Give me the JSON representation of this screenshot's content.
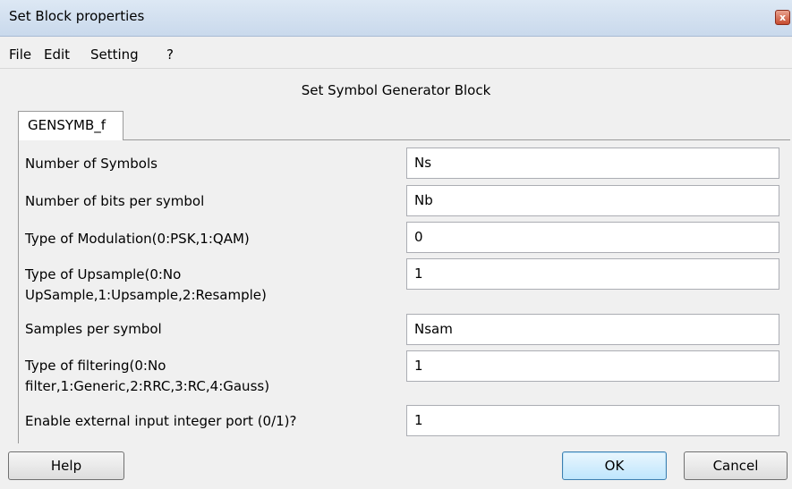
{
  "window": {
    "title": "Set Block properties",
    "close_glyph": "x"
  },
  "menu": {
    "items": [
      "File",
      "Edit",
      "Setting",
      "?"
    ]
  },
  "header": {
    "title": "Set Symbol Generator Block"
  },
  "tabs": [
    {
      "label": "GENSYMB_f",
      "selected": true
    }
  ],
  "fields": [
    {
      "label": "Number of Symbols",
      "value": "Ns"
    },
    {
      "label": "Number of bits per symbol",
      "value": "Nb"
    },
    {
      "label": "Type of Modulation(0:PSK,1:QAM)",
      "value": "0"
    },
    {
      "label": "Type of Upsample(0:No\nUpSample,1:Upsample,2:Resample)",
      "label_line1": "Type of Upsample(0:No",
      "label_line2": "UpSample,1:Upsample,2:Resample)",
      "value": "1"
    },
    {
      "label": "Samples per symbol",
      "value": "Nsam"
    },
    {
      "label": "Type of filtering(0:No\nfilter,1:Generic,2:RRC,3:RC,4:Gauss)",
      "label_line1": "Type of filtering(0:No",
      "label_line2": "filter,1:Generic,2:RRC,3:RC,4:Gauss)",
      "value": "1"
    },
    {
      "label": "Enable external input integer port (0/1)?",
      "value": "1"
    }
  ],
  "buttons": {
    "help": "Help",
    "ok": "OK",
    "cancel": "Cancel"
  },
  "colors": {
    "titlebar": "#c9d9ec",
    "window_bg": "#f0f0f0",
    "close_button": "#c74b2f",
    "default_button_border": "#3c7fb1"
  }
}
